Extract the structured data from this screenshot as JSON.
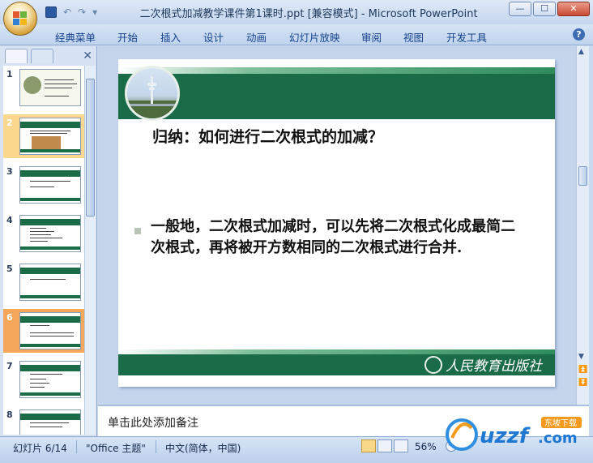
{
  "window": {
    "title": "二次根式加减教学课件第1课时.ppt [兼容模式] - Microsoft PowerPoint",
    "min_symbol": "—",
    "max_symbol": "☐",
    "close_symbol": "✕"
  },
  "ribbon": {
    "tabs": [
      "经典菜单",
      "开始",
      "插入",
      "设计",
      "动画",
      "幻灯片放映",
      "审阅",
      "视图",
      "开发工具"
    ],
    "help": "?"
  },
  "slide_panel": {
    "close_symbol": "✕",
    "thumbnails": [
      {
        "num": "1"
      },
      {
        "num": "2"
      },
      {
        "num": "3"
      },
      {
        "num": "4"
      },
      {
        "num": "5"
      },
      {
        "num": "6"
      },
      {
        "num": "7"
      },
      {
        "num": "8"
      }
    ]
  },
  "slide": {
    "title": "归纳：如何进行二次根式的加减？",
    "body": "一般地，二次根式加减时，可以先将二次根式化成最简二次根式，再将被开方数相同的二次根式进行合并.",
    "publisher": "人民教育出版社"
  },
  "notes": {
    "placeholder": "单击此处添加备注"
  },
  "statusbar": {
    "slide_info": "幻灯片 6/14",
    "theme": "\"Office 主题\"",
    "language": "中文(简体，中国)",
    "zoom": "56%"
  },
  "watermark": {
    "brand": "uzzf",
    "domain": ".com",
    "tagline": "东坡下载"
  },
  "colors": {
    "slide_green": "#1a6b47",
    "ribbon_text": "#15428b",
    "selected_thumb": "#fcd78e"
  }
}
